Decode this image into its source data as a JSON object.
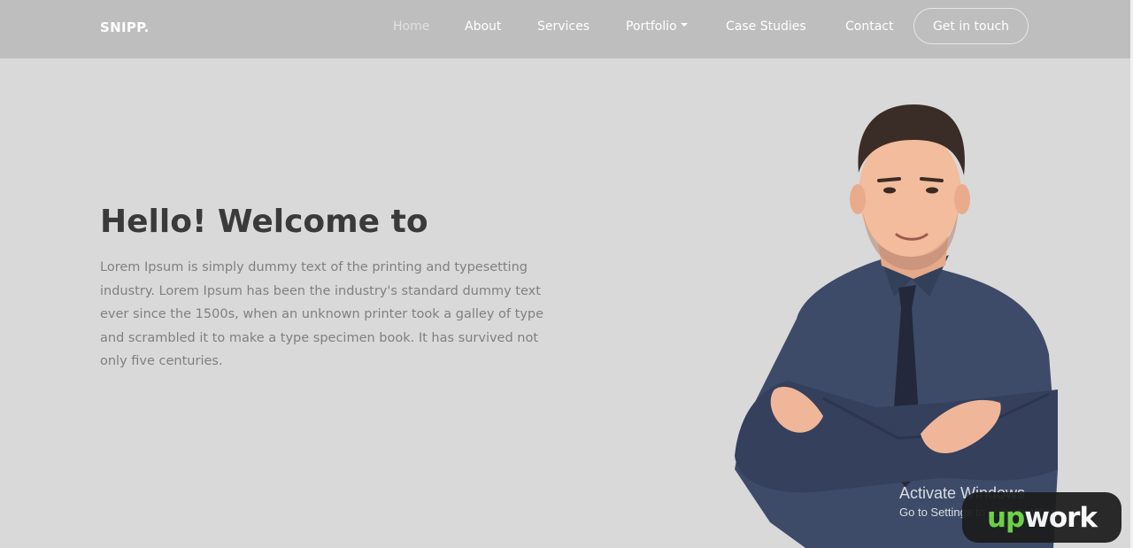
{
  "navbar": {
    "brand": "SNIPP.",
    "links": [
      {
        "label": "Home",
        "active": true
      },
      {
        "label": "About"
      },
      {
        "label": "Services"
      },
      {
        "label": "Portfolio",
        "dropdown": true
      },
      {
        "label": "Case Studies"
      },
      {
        "label": "Contact"
      }
    ],
    "cta_label": "Get in touch"
  },
  "hero": {
    "title": "Hello! Welcome to",
    "body": "Lorem Ipsum is simply dummy text of the printing and typesetting industry. Lorem Ipsum has been the industry's standard dummy text ever since the 1500s, when an unknown printer took a galley of type and scrambled it to make a type specimen book. It has survived not only five centuries."
  },
  "watermark": {
    "activate_title": "Activate Windows",
    "activate_sub": "Go to Settings to activate Windows."
  },
  "upwork_logo": {
    "up": "up",
    "work": "work"
  },
  "colors": {
    "navbar_bg": "#bebebe",
    "page_bg": "#d9d9d9",
    "heading": "#3a3a3a",
    "body_text": "#808080",
    "upwork_green": "#6fda44",
    "shirt": "#3d4b68"
  }
}
